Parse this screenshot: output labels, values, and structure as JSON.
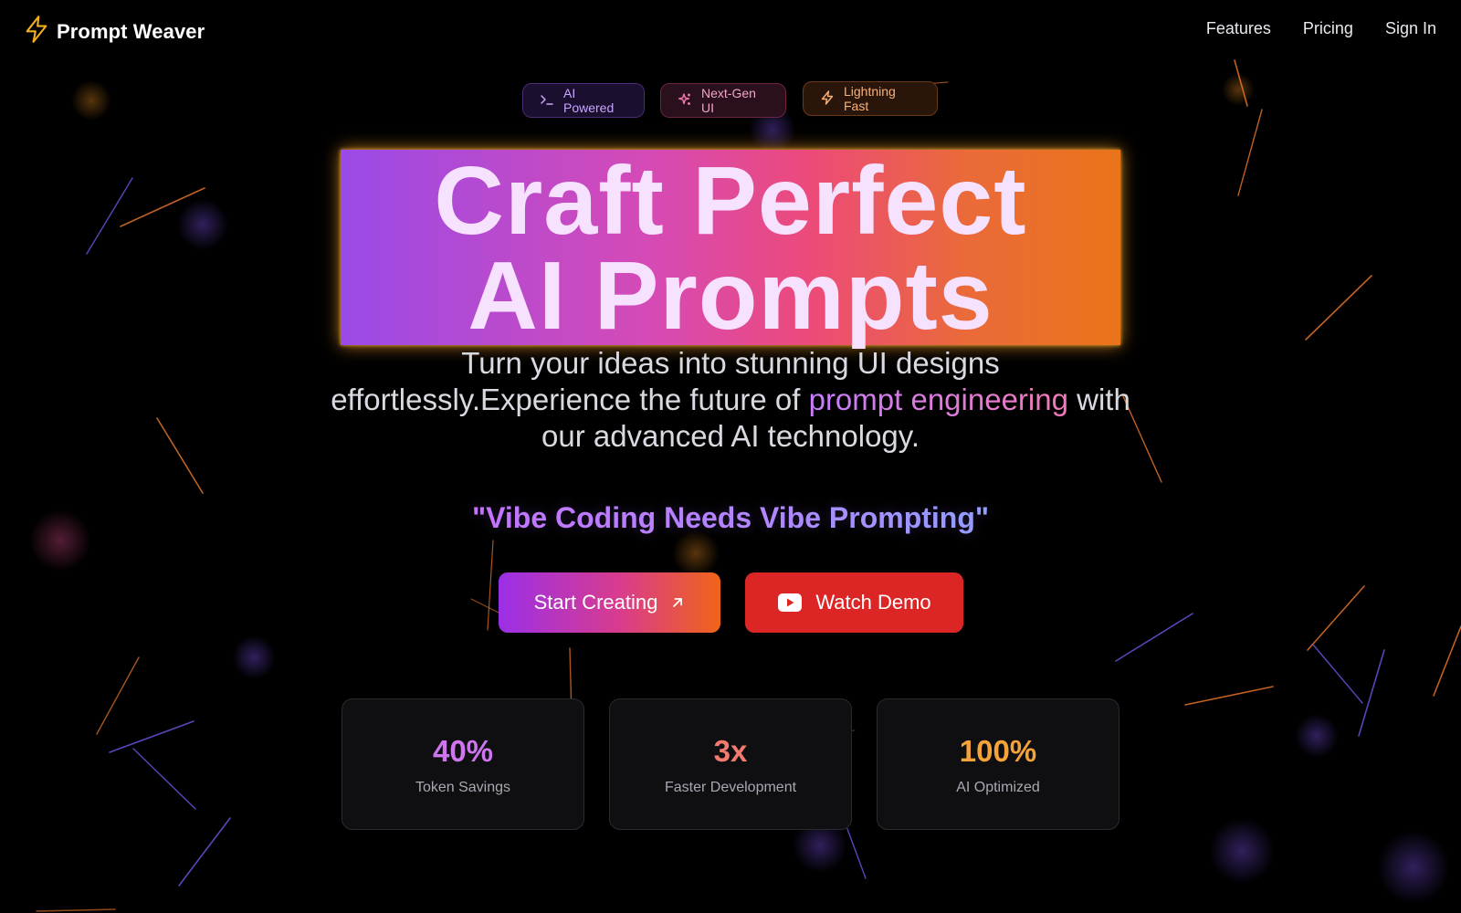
{
  "brand": {
    "name": "Prompt Weaver",
    "icon": "lightning-icon",
    "icon_color": "#f2b01e"
  },
  "nav": {
    "links": [
      "Features",
      "Pricing",
      "Sign In"
    ]
  },
  "badges": [
    {
      "label": "AI Powered",
      "icon": "terminal-icon"
    },
    {
      "label": "Next-Gen UI",
      "icon": "sparkles-icon"
    },
    {
      "label": "Lightning Fast",
      "icon": "lightning-icon"
    }
  ],
  "hero": {
    "title_line1": "Craft Perfect",
    "title_line2": "AI Prompts",
    "subtitle_before": "Turn your ideas into stunning UI designs effortlessly.Experience the future of ",
    "subtitle_highlight": "prompt engineering",
    "subtitle_after": " with our advanced AI technology.",
    "tagline": "\"Vibe Coding Needs Vibe Prompting\""
  },
  "buttons": {
    "start": {
      "label": "Start Creating",
      "icon": "arrow-up-right-icon"
    },
    "demo": {
      "label": "Watch Demo",
      "icon": "youtube-play-icon"
    }
  },
  "stats": [
    {
      "value": "40%",
      "label": "Token Savings"
    },
    {
      "value": "3x",
      "label": "Faster Development"
    },
    {
      "value": "100%",
      "label": "AI Optimized"
    }
  ],
  "colors": {
    "accent_purple": "#9b2fe8",
    "accent_pink": "#d93c8c",
    "accent_orange": "#f06418",
    "demo_red": "#dc2626",
    "background": "#000000"
  }
}
